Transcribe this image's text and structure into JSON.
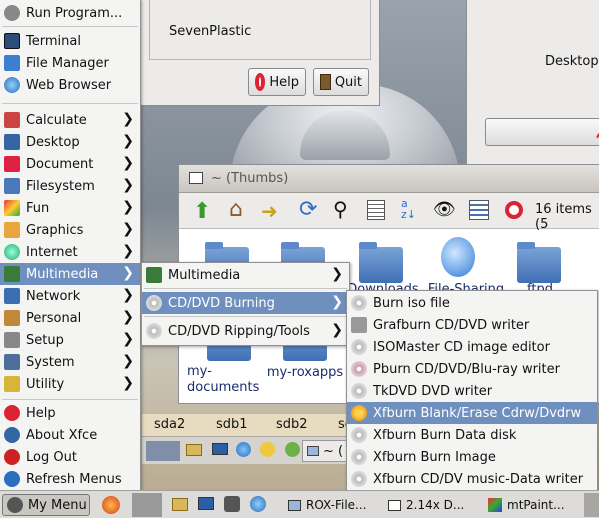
{
  "top_dialog": {
    "label": "SevenPlastic",
    "help": "Help",
    "quit": "Quit"
  },
  "desktop_dialog": {
    "label": "Desktop"
  },
  "rox": {
    "title": "~ (Thumbs)",
    "item_count": "16 items (5",
    "items": [
      "Downloads",
      "File-Sharing",
      "ftpd",
      "my-documents",
      "my-roxapps"
    ],
    "drives": [
      "sda2",
      "sdb1",
      "sdb2",
      "sd"
    ],
    "path_prefix": "~ ("
  },
  "main_menu": {
    "run": "Run Program...",
    "group1": [
      "Terminal",
      "File Manager",
      "Web Browser"
    ],
    "categories": [
      "Calculate",
      "Desktop",
      "Document",
      "Filesystem",
      "Fun",
      "Graphics",
      "Internet",
      "Multimedia",
      "Network",
      "Personal",
      "Setup",
      "System",
      "Utility"
    ],
    "group3": [
      "Help",
      "About Xfce",
      "Log Out",
      "Refresh Menus"
    ]
  },
  "multimedia_menu": [
    "Multimedia",
    "CD/DVD Burning",
    "CD/DVD Ripping/Tools"
  ],
  "burning_menu": [
    "Burn iso file",
    "Grafburn CD/DVD writer",
    "ISOMaster CD image editor",
    "Pburn CD/DVD/Blu-ray writer",
    "TkDVD DVD writer",
    "Xfburn Blank/Erase Cdrw/Dvdrw",
    "Xfburn Burn Data disk",
    "Xfburn Burn Image",
    "Xfburn CD/DV music-Data writer"
  ],
  "taskbar": {
    "menu": "My Menu",
    "tasks": [
      "ROX-File...",
      "2.14x D...",
      "mtPaint..."
    ]
  }
}
